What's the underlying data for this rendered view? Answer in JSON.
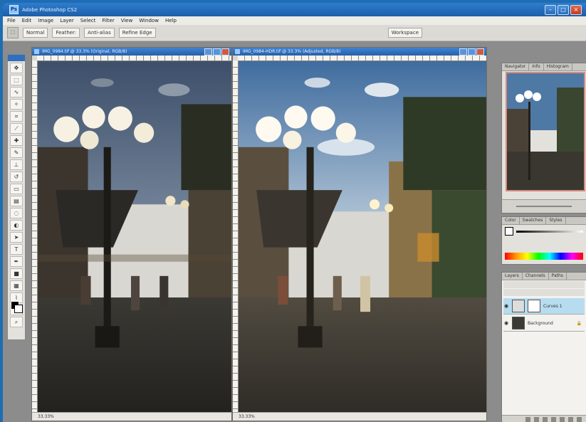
{
  "app": {
    "title": "Adobe Photoshop CS2"
  },
  "menubar": {
    "items": [
      "File",
      "Edit",
      "Image",
      "Layer",
      "Select",
      "Filter",
      "View",
      "Window",
      "Help"
    ]
  },
  "options": {
    "style_label": "Normal",
    "feather_label": "Feather:",
    "antialias_label": "Anti-alias",
    "refine_label": "Refine Edge",
    "workspace_label": "Workspace"
  },
  "documents": [
    {
      "title": "IMG_0984.tif @ 33.3% (Original, RGB/8)",
      "status": "33.33%"
    },
    {
      "title": "IMG_0984-HDR.tif @ 33.3% (Adjusted, RGB/8)",
      "status": "33.33%"
    }
  ],
  "panels": {
    "navigator_tabs": [
      "Navigator",
      "Info",
      "Histogram"
    ],
    "color_tabs": [
      "Color",
      "Swatches",
      "Styles"
    ],
    "layers_tabs": [
      "Layers",
      "Channels",
      "Paths"
    ],
    "layers": [
      {
        "name": "Curves 1"
      },
      {
        "name": "Background"
      }
    ]
  },
  "colors": {
    "chrome_blue": "#1e6db3",
    "workspace_gray": "#8c8c8c",
    "layer_selected": "#b7dcef"
  }
}
